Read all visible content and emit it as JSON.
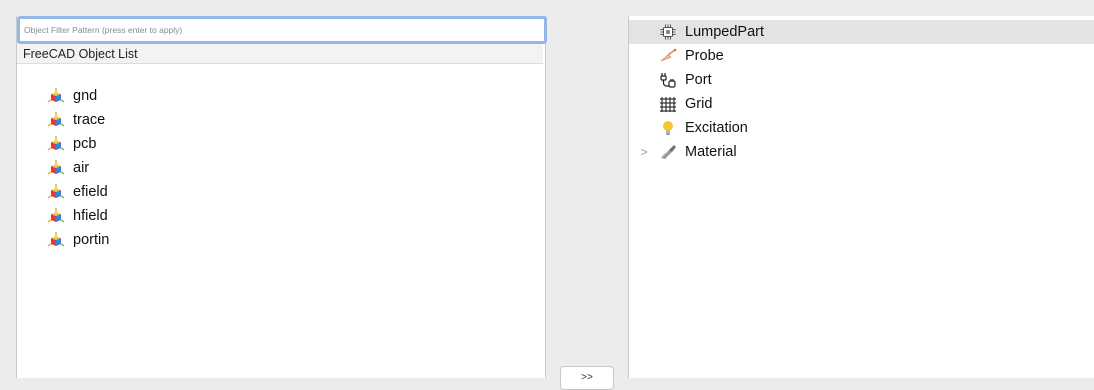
{
  "filter": {
    "placeholder": "Object Filter Pattern (press enter to apply)",
    "value": ""
  },
  "object_list": {
    "header": "FreeCAD Object List",
    "items": [
      {
        "label": "gnd",
        "icon": "freecad-part-icon"
      },
      {
        "label": "trace",
        "icon": "freecad-part-icon"
      },
      {
        "label": "pcb",
        "icon": "freecad-part-icon"
      },
      {
        "label": "air",
        "icon": "freecad-part-icon"
      },
      {
        "label": "efield",
        "icon": "freecad-part-icon"
      },
      {
        "label": "hfield",
        "icon": "freecad-part-icon"
      },
      {
        "label": "portin",
        "icon": "freecad-part-icon"
      }
    ]
  },
  "move_button": {
    "label": ">>"
  },
  "settings_tree": {
    "items": [
      {
        "label": "LumpedPart",
        "icon": "chip-icon",
        "selected": true
      },
      {
        "label": "Probe",
        "icon": "probe-icon"
      },
      {
        "label": "Port",
        "icon": "port-icon"
      },
      {
        "label": "Grid",
        "icon": "grid-icon"
      },
      {
        "label": "Excitation",
        "icon": "lightbulb-icon"
      },
      {
        "label": "Material",
        "icon": "material-icon",
        "expandable": true,
        "expanded": false,
        "expander": ">"
      }
    ]
  },
  "colors": {
    "focus_ring": "#94b7ea",
    "selection": "#e3e3e3",
    "panel": "#ffffff",
    "window": "#ececec"
  }
}
